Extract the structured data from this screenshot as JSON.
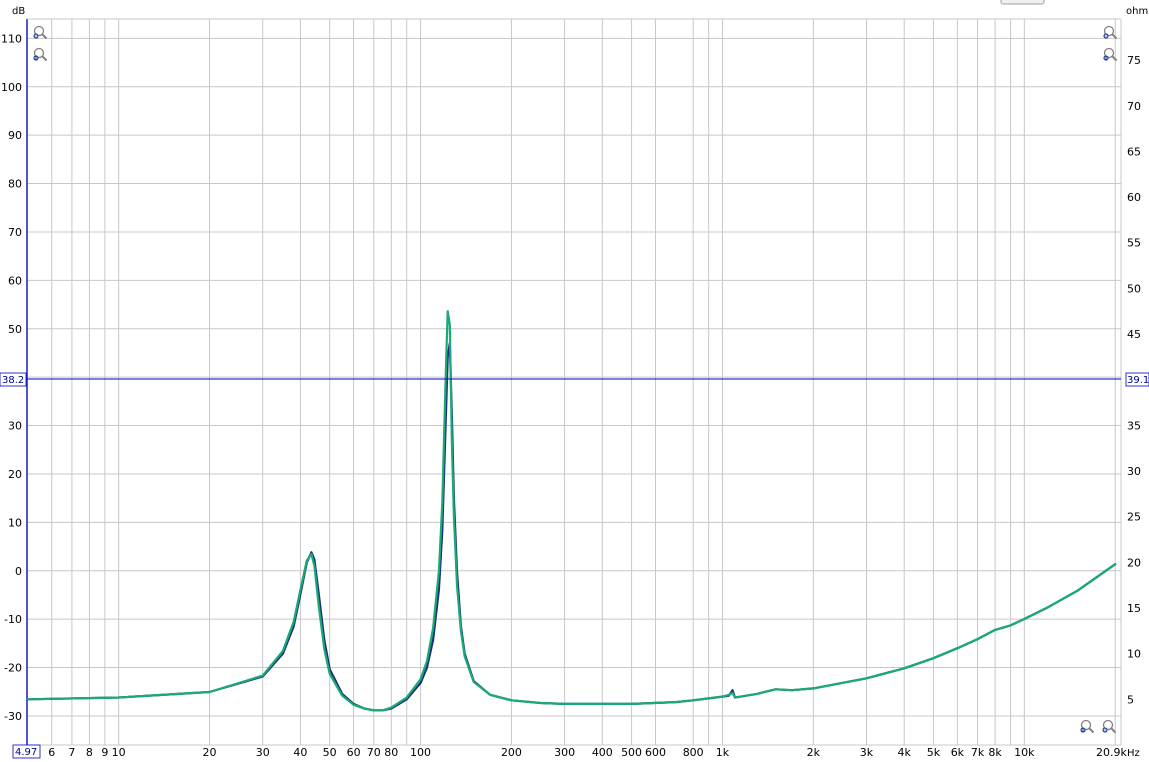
{
  "chart_data": {
    "type": "line",
    "x_scale": "log",
    "xlim": [
      4.97,
      20900
    ],
    "ylim_left": [
      -36,
      114
    ],
    "ylim_right": [
      0,
      79.5
    ],
    "left_unit": "dB",
    "right_unit": "ohm",
    "x_unit": "Hz",
    "grid": true,
    "x_start_label": "4.97",
    "x_end_label": "20.9k",
    "x_ticks": [
      {
        "v": 6,
        "label": "6"
      },
      {
        "v": 7,
        "label": "7"
      },
      {
        "v": 8,
        "label": "8"
      },
      {
        "v": 9,
        "label": "9"
      },
      {
        "v": 10,
        "label": "10"
      },
      {
        "v": 20,
        "label": "20"
      },
      {
        "v": 30,
        "label": "30"
      },
      {
        "v": 40,
        "label": "40"
      },
      {
        "v": 50,
        "label": "50"
      },
      {
        "v": 60,
        "label": "60"
      },
      {
        "v": 70,
        "label": "70"
      },
      {
        "v": 80,
        "label": "80"
      },
      {
        "v": 100,
        "label": "100"
      },
      {
        "v": 200,
        "label": "200"
      },
      {
        "v": 300,
        "label": "300"
      },
      {
        "v": 400,
        "label": "400"
      },
      {
        "v": 500,
        "label": "500"
      },
      {
        "v": 600,
        "label": "600"
      },
      {
        "v": 800,
        "label": "800"
      },
      {
        "v": 1000,
        "label": "1k"
      },
      {
        "v": 2000,
        "label": "2k"
      },
      {
        "v": 3000,
        "label": "3k"
      },
      {
        "v": 4000,
        "label": "4k"
      },
      {
        "v": 5000,
        "label": "5k"
      },
      {
        "v": 6000,
        "label": "6k"
      },
      {
        "v": 7000,
        "label": "7k"
      },
      {
        "v": 8000,
        "label": "8k"
      },
      {
        "v": 10000,
        "label": "10k"
      }
    ],
    "x_minor_grid": [
      90,
      900,
      9000,
      20000
    ],
    "y_left_ticks": [
      110,
      100,
      90,
      80,
      70,
      60,
      50,
      40,
      30,
      20,
      10,
      0,
      -10,
      -20,
      -30
    ],
    "y_right_ticks": [
      75,
      70,
      65,
      60,
      55,
      50,
      45,
      40,
      35,
      30,
      25,
      20,
      15,
      10,
      5
    ],
    "cursor": {
      "left_value": "38.2",
      "right_value": "39.1"
    },
    "series": [
      {
        "color": "#1c2f7a",
        "width": 2.2,
        "x": [
          5,
          10,
          20,
          30,
          35,
          38,
          40,
          42,
          43.5,
          44.5,
          46,
          48,
          50,
          55,
          60,
          65,
          70,
          75,
          80,
          90,
          100,
          105,
          110,
          115,
          118,
          121,
          123,
          125,
          127,
          129,
          132,
          136,
          140,
          150,
          170,
          200,
          250,
          300,
          350,
          500,
          700,
          800,
          900,
          1000,
          1050,
          1080,
          1100,
          1150,
          1300,
          1500,
          1700,
          2000,
          3000,
          4000,
          5000,
          6000,
          7000,
          8000,
          9000,
          10000,
          12000,
          15000,
          20000
        ],
        "y": [
          5.0,
          5.2,
          5.8,
          7.5,
          10.0,
          13.0,
          16.5,
          20.0,
          21.1,
          20.3,
          16.5,
          11.5,
          8.3,
          5.6,
          4.5,
          4.0,
          3.8,
          3.8,
          4.0,
          5.0,
          6.8,
          8.5,
          11.5,
          17.0,
          23.5,
          35.0,
          42.5,
          44.0,
          36.0,
          27.0,
          19.0,
          13.0,
          10.0,
          7.0,
          5.5,
          4.9,
          4.6,
          4.5,
          4.5,
          4.5,
          4.7,
          4.9,
          5.1,
          5.3,
          5.4,
          6.0,
          5.2,
          5.3,
          5.6,
          6.1,
          6.0,
          6.2,
          7.3,
          8.4,
          9.5,
          10.6,
          11.6,
          12.6,
          13.1,
          13.8,
          15.1,
          16.9,
          19.8
        ]
      },
      {
        "color": "#1aaa75",
        "width": 2.2,
        "x": [
          5,
          10,
          20,
          30,
          35,
          38,
          40,
          42,
          43.5,
          44.5,
          46,
          48,
          50,
          55,
          60,
          65,
          70,
          75,
          80,
          90,
          100,
          105,
          110,
          115,
          118,
          121,
          123,
          125,
          127,
          129,
          132,
          136,
          140,
          150,
          170,
          200,
          250,
          300,
          350,
          500,
          700,
          800,
          900,
          1000,
          1050,
          1080,
          1100,
          1150,
          1300,
          1500,
          1700,
          2000,
          3000,
          4000,
          5000,
          6000,
          7000,
          8000,
          9000,
          10000,
          12000,
          15000,
          20000
        ],
        "y": [
          5.0,
          5.2,
          5.8,
          7.6,
          10.3,
          13.5,
          17.0,
          20.2,
          20.9,
          19.6,
          15.2,
          10.5,
          7.8,
          5.4,
          4.4,
          4.0,
          3.8,
          3.8,
          4.1,
          5.2,
          7.2,
          9.2,
          12.8,
          19.0,
          26.5,
          40.0,
          47.5,
          46.0,
          33.0,
          25.0,
          17.5,
          12.5,
          9.7,
          6.9,
          5.5,
          4.9,
          4.6,
          4.5,
          4.5,
          4.5,
          4.7,
          4.9,
          5.1,
          5.3,
          5.5,
          5.7,
          5.2,
          5.3,
          5.6,
          6.1,
          6.0,
          6.2,
          7.3,
          8.4,
          9.5,
          10.6,
          11.6,
          12.6,
          13.1,
          13.8,
          15.1,
          16.9,
          19.8
        ]
      }
    ]
  },
  "icons": {
    "zoom_in": "zoom-in-icon",
    "zoom_out": "zoom-out-icon"
  },
  "colors": {
    "grid": "#c8c8c8",
    "axis": "#1a1acd",
    "cursor": "#0000cd",
    "tick_text": "#000000"
  }
}
